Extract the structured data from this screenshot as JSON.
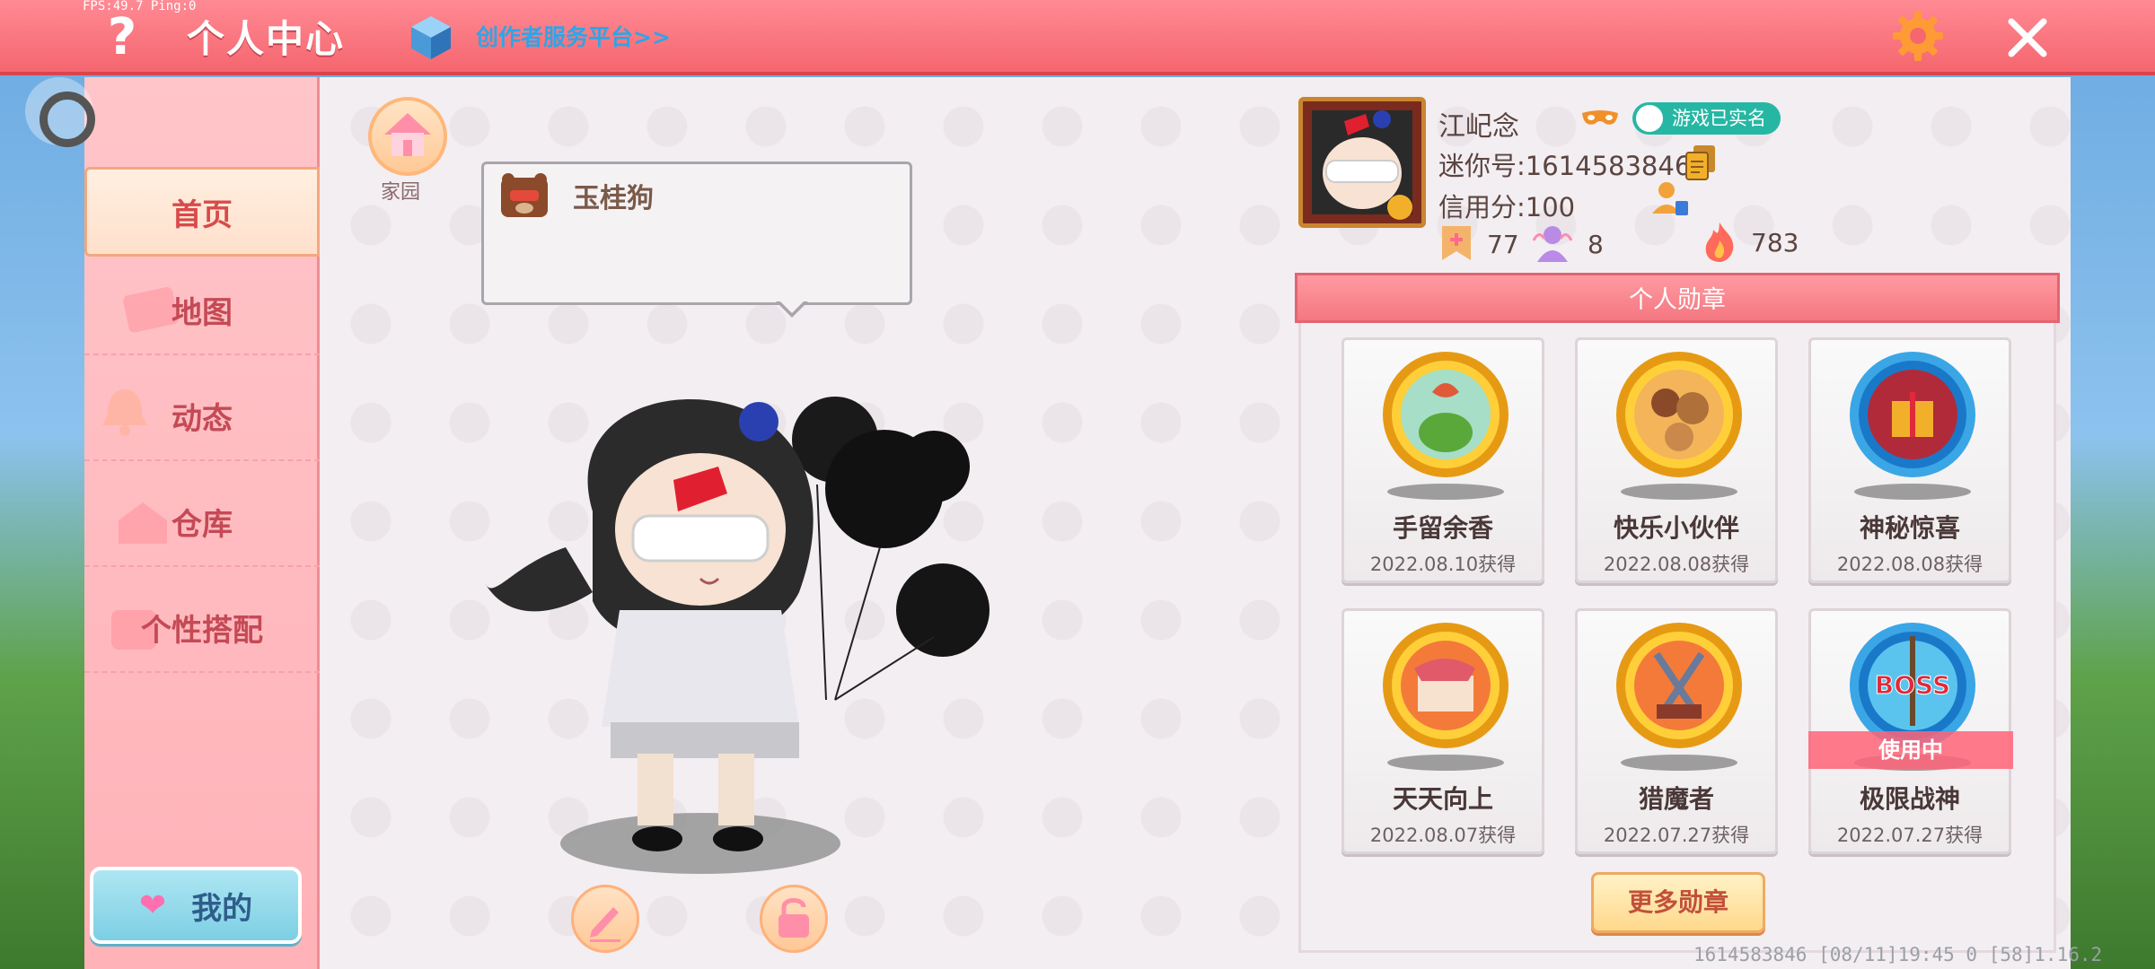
{
  "debug": {
    "fps_text": "FPS:49.7  Ping:0"
  },
  "header": {
    "title": "个人中心",
    "creator_link": "创作者服务平台>>"
  },
  "sidebar": {
    "items": [
      {
        "label": "首页",
        "active": true
      },
      {
        "label": "地图"
      },
      {
        "label": "动态"
      },
      {
        "label": "仓库"
      },
      {
        "label": "个性搭配"
      }
    ],
    "mine_label": "我的"
  },
  "home": {
    "label": "家园"
  },
  "bubble": {
    "name": "玉桂狗"
  },
  "profile": {
    "name": "江屺念",
    "realname_badge": "游戏已实名",
    "mini_id": "迷你号:1614583846",
    "credit": "信用分:100",
    "stats": [
      "77",
      "8",
      "783"
    ]
  },
  "medals": {
    "title": "个人勋章",
    "items": [
      {
        "name": "手留余香",
        "date": "2022.08.10获得"
      },
      {
        "name": "快乐小伙伴",
        "date": "2022.08.08获得"
      },
      {
        "name": "神秘惊喜",
        "date": "2022.08.08获得"
      },
      {
        "name": "天天向上",
        "date": "2022.08.07获得"
      },
      {
        "name": "猎魔者",
        "date": "2022.07.27获得"
      },
      {
        "name": "极限战神",
        "date": "2022.07.27获得",
        "in_use": "使用中",
        "emblem_text": "BOSS"
      }
    ],
    "more_label": "更多勋章"
  },
  "footer": {
    "info": "1614583846    [08/11]19:45 0  [58]1.16.2"
  },
  "colors": {
    "header": "#f5666f",
    "sidebar": "#ffb2b8",
    "teal": "#26b7a4",
    "gold": "#f2b02a"
  }
}
